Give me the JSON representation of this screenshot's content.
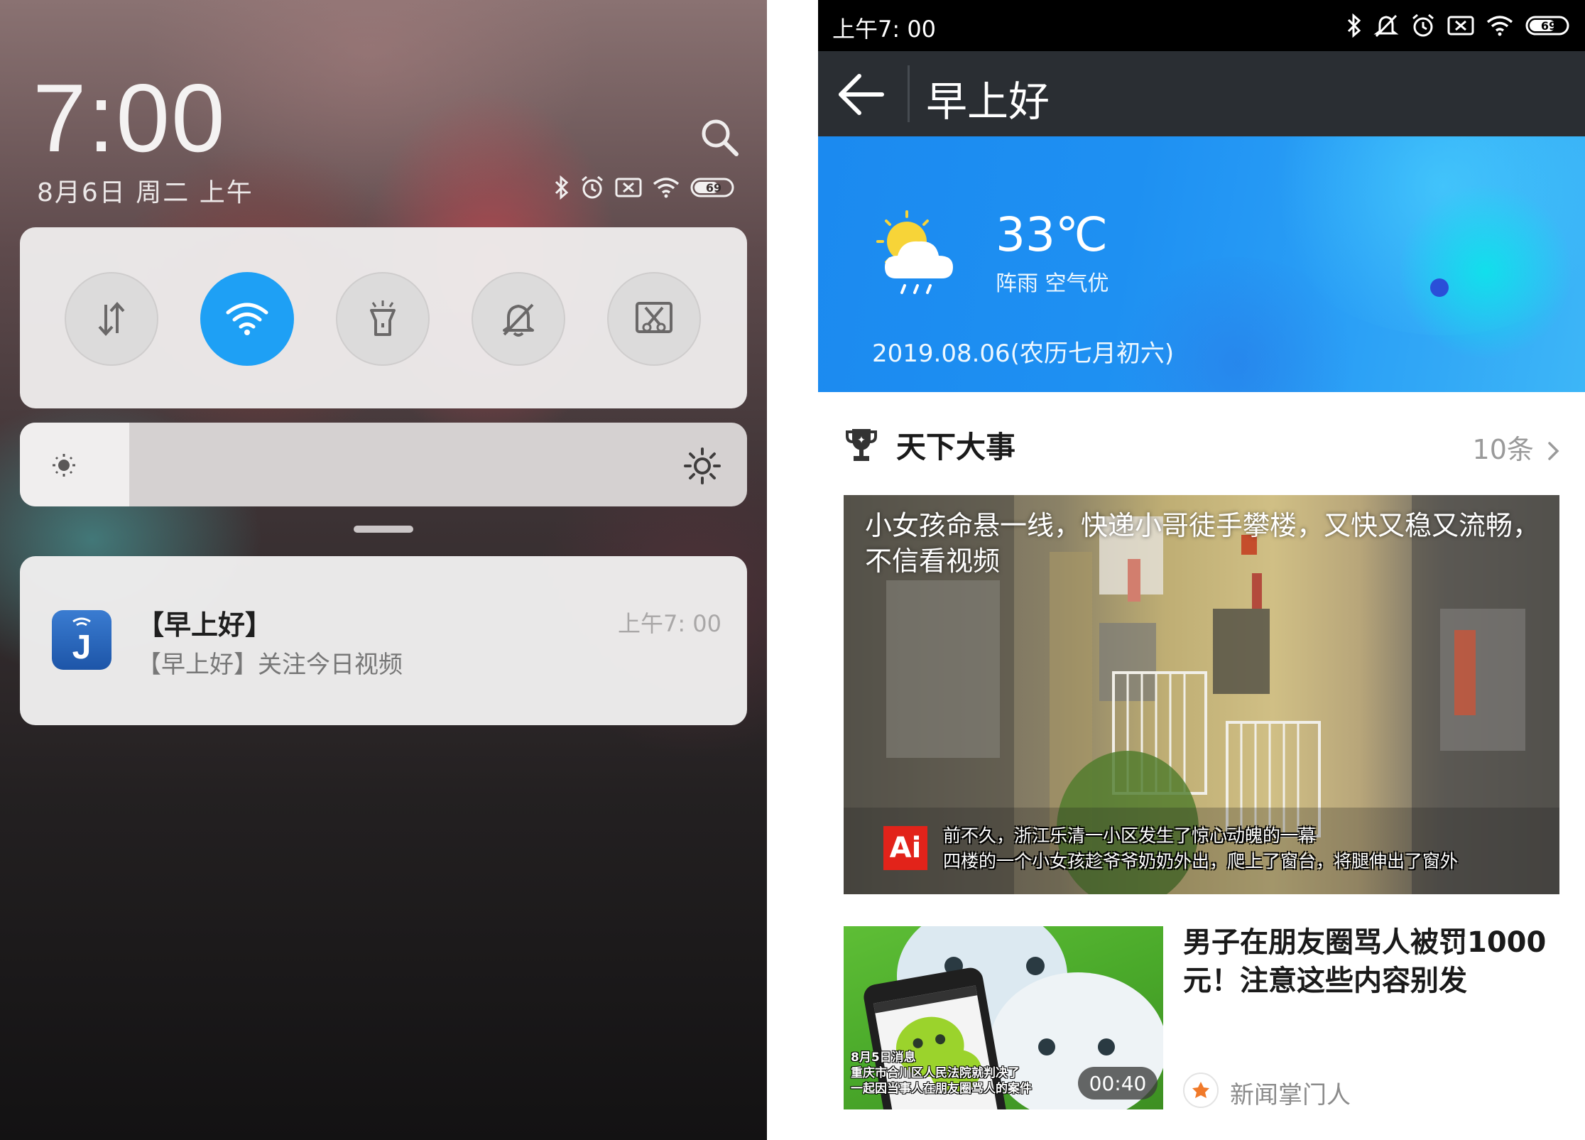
{
  "left": {
    "clock": "7:00",
    "date": "8月6日 周二 上午",
    "battery": "69",
    "quick_settings": [
      {
        "id": "data-toggle",
        "icon": "data-arrows-icon",
        "active": false
      },
      {
        "id": "wifi-toggle",
        "icon": "wifi-icon",
        "active": true
      },
      {
        "id": "flashlight-toggle",
        "icon": "flashlight-icon",
        "active": false
      },
      {
        "id": "mute-toggle",
        "icon": "bell-off-icon",
        "active": false
      },
      {
        "id": "screenshot-toggle",
        "icon": "screenshot-icon",
        "active": false
      }
    ],
    "brightness_level": 0.15,
    "notification": {
      "title": "【早上好】",
      "body": "【早上好】关注今日视频",
      "time": "上午7: 00",
      "app_letter": "J"
    }
  },
  "right": {
    "status_time": "上午7: 00",
    "battery": "69",
    "header_title": "早上好",
    "weather": {
      "temperature": "33℃",
      "condition": "阵雨 空气优",
      "date": "2019.08.06(农历七月初六)"
    },
    "section": {
      "title": "天下大事",
      "count": "10条"
    },
    "article1": {
      "title": "小女孩命悬一线，快递小哥徒手攀楼，又快又稳又流畅，不信看视频",
      "badge": "Ai",
      "subtitle1": "前不久，浙江乐清一小区发生了惊心动魄的一幕",
      "subtitle2": "四楼的一个小女孩趁爷爷奶奶外出，爬上了窗台，将腿伸出了窗外"
    },
    "article2": {
      "title": "男子在朋友圈骂人被罚1000元！注意这些内容别发",
      "caption1": "8月5日消息",
      "caption2": "重庆市合川区人民法院就判决了",
      "caption3": "一起因当事人在朋友圈骂人的案件",
      "duration": "00:40",
      "source": "新闻掌门人"
    }
  }
}
